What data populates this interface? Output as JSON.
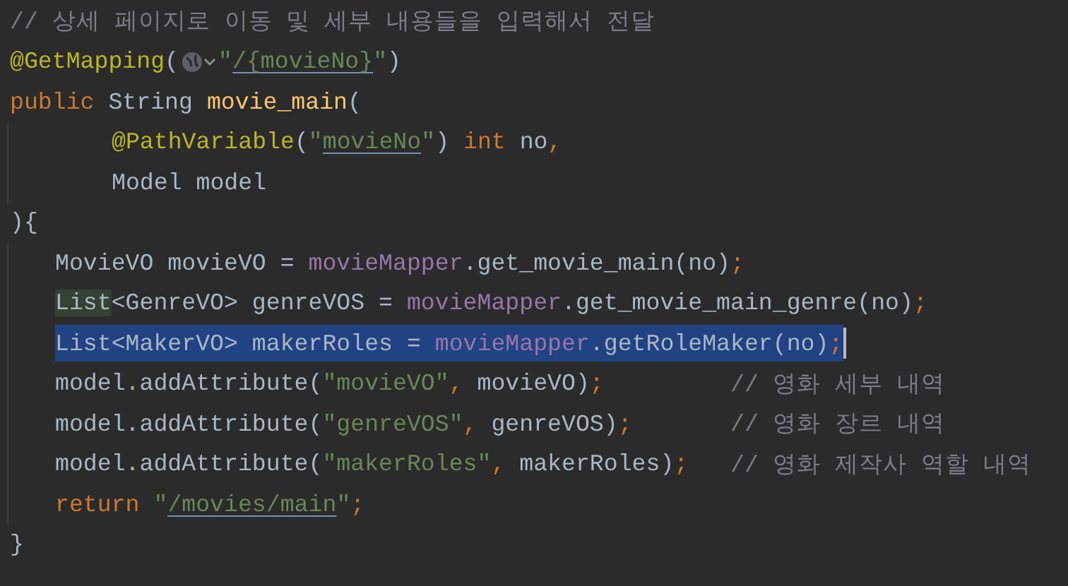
{
  "editor": {
    "lines": [
      {
        "selected": false,
        "caret": false,
        "tokens": [
          {
            "text": "// 상세 페이지로 이동 및 세부 내용들을 입력해서 전달",
            "kind": "comment"
          }
        ]
      },
      {
        "selected": false,
        "caret": false,
        "tokens": [
          {
            "text": "@GetMapping",
            "kind": "annotation"
          },
          {
            "text": "(",
            "kind": "plain"
          },
          {
            "kind": "globe_icon"
          },
          {
            "text": "\"",
            "kind": "string"
          },
          {
            "text": "/{movieNo}",
            "kind": "link"
          },
          {
            "text": "\"",
            "kind": "string"
          },
          {
            "text": ")",
            "kind": "plain"
          }
        ]
      },
      {
        "selected": false,
        "caret": false,
        "tokens": [
          {
            "text": "public ",
            "kind": "keyword"
          },
          {
            "text": "String ",
            "kind": "plain"
          },
          {
            "text": "movie_main",
            "kind": "method"
          },
          {
            "text": "(",
            "kind": "plain"
          }
        ],
        "children": [
          {
            "kind": "continuation",
            "selected": false,
            "caret": false,
            "tokens": [
              {
                "text": "@PathVariable",
                "kind": "annotation"
              },
              {
                "text": "(",
                "kind": "plain"
              },
              {
                "text": "\"",
                "kind": "string"
              },
              {
                "text": "movieNo",
                "kind": "link"
              },
              {
                "text": "\"",
                "kind": "string"
              },
              {
                "text": ") ",
                "kind": "plain"
              },
              {
                "text": "int",
                "kind": "keyword"
              },
              {
                "text": " no",
                "kind": "plain"
              },
              {
                "text": ",",
                "kind": "punct"
              }
            ]
          },
          {
            "kind": "continuation",
            "selected": false,
            "caret": false,
            "tokens": [
              {
                "text": "Model model",
                "kind": "plain"
              }
            ]
          }
        ]
      },
      {
        "selected": false,
        "caret": false,
        "tokens": [
          {
            "text": "){",
            "kind": "plain"
          }
        ],
        "children": [
          {
            "kind": "statement",
            "selected": false,
            "caret": false,
            "tokens": [
              {
                "text": "MovieVO movieVO = ",
                "kind": "plain"
              },
              {
                "text": "movieMapper",
                "kind": "field"
              },
              {
                "text": ".get_movie_main(no)",
                "kind": "plain"
              },
              {
                "text": ";",
                "kind": "punct"
              }
            ]
          },
          {
            "kind": "statement",
            "selected": false,
            "caret": false,
            "tokens": [
              {
                "text": "List",
                "kind": "usage"
              },
              {
                "text": "<GenreVO> genreVOS = ",
                "kind": "plain"
              },
              {
                "text": "movieMapper",
                "kind": "field"
              },
              {
                "text": ".get_movie_main_genre(no)",
                "kind": "plain"
              },
              {
                "text": ";",
                "kind": "punct"
              }
            ]
          },
          {
            "kind": "statement",
            "selected": true,
            "caret": true,
            "tokens": [
              {
                "text": "List<MakerVO> makerRoles = ",
                "kind": "plain"
              },
              {
                "text": "movieMapper",
                "kind": "field"
              },
              {
                "text": ".getRoleMaker(no)",
                "kind": "plain"
              },
              {
                "text": ";",
                "kind": "punct"
              }
            ]
          },
          {
            "kind": "statement",
            "selected": false,
            "caret": false,
            "tokens": [
              {
                "text": "model.addAttribute(",
                "kind": "plain"
              },
              {
                "text": "\"movieVO\"",
                "kind": "string"
              },
              {
                "text": ",",
                "kind": "punct"
              },
              {
                "text": " movieVO)",
                "kind": "plain"
              },
              {
                "text": ";",
                "kind": "punct"
              },
              {
                "text": "         // 영화 세부 내역",
                "kind": "comment"
              }
            ]
          },
          {
            "kind": "statement",
            "selected": false,
            "caret": false,
            "tokens": [
              {
                "text": "model.addAttribute(",
                "kind": "plain"
              },
              {
                "text": "\"genreVOS\"",
                "kind": "string"
              },
              {
                "text": ",",
                "kind": "punct"
              },
              {
                "text": " genreVOS)",
                "kind": "plain"
              },
              {
                "text": ";",
                "kind": "punct"
              },
              {
                "text": "       // 영화 장르 내역",
                "kind": "comment"
              }
            ]
          },
          {
            "kind": "statement",
            "selected": false,
            "caret": false,
            "tokens": [
              {
                "text": "model.addAttribute(",
                "kind": "plain"
              },
              {
                "text": "\"makerRoles\"",
                "kind": "string"
              },
              {
                "text": ",",
                "kind": "punct"
              },
              {
                "text": " makerRoles)",
                "kind": "plain"
              },
              {
                "text": ";",
                "kind": "punct"
              },
              {
                "text": "   // 영화 제작사 역할 내역",
                "kind": "comment"
              }
            ]
          },
          {
            "kind": "statement",
            "selected": false,
            "caret": false,
            "tokens": [
              {
                "text": "return ",
                "kind": "keyword"
              },
              {
                "text": "\"",
                "kind": "string"
              },
              {
                "text": "/movies/main",
                "kind": "link"
              },
              {
                "text": "\"",
                "kind": "string"
              },
              {
                "text": ";",
                "kind": "punct"
              }
            ]
          }
        ]
      },
      {
        "selected": false,
        "caret": false,
        "tokens": [
          {
            "text": "}",
            "kind": "plain"
          }
        ]
      }
    ]
  }
}
